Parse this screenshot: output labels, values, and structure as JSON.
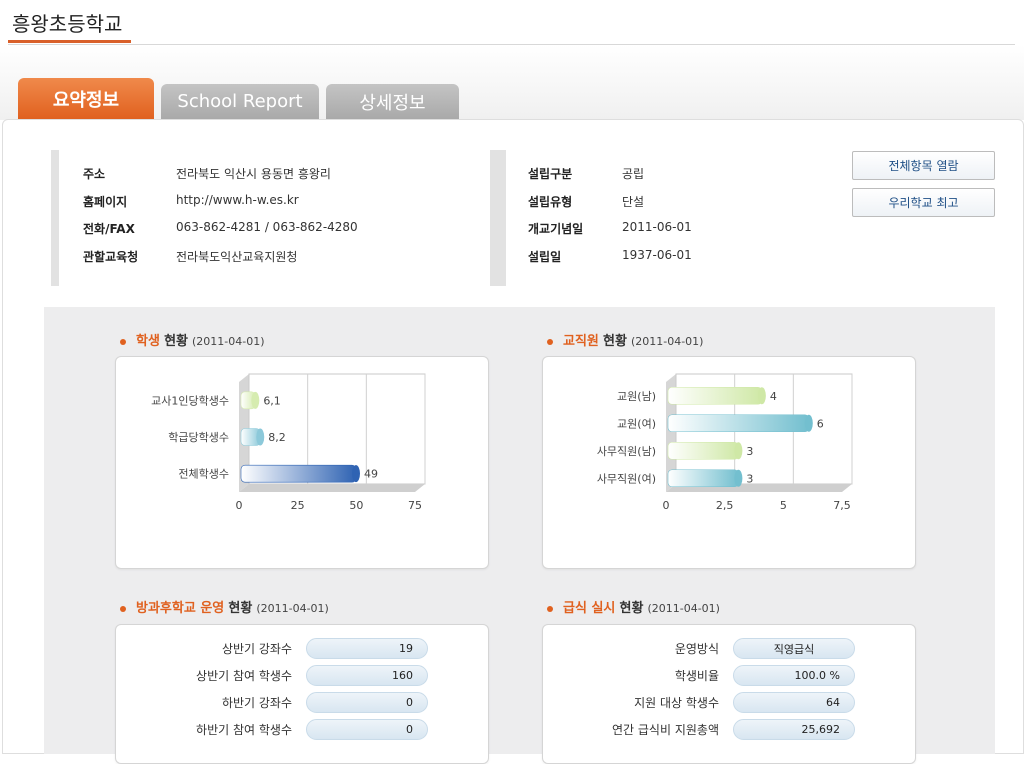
{
  "page": {
    "title": "흥왕초등학교"
  },
  "tabs": [
    {
      "label": "요약정보",
      "active": true
    },
    {
      "label": "School Report",
      "active": false
    },
    {
      "label": "상세정보",
      "active": false
    }
  ],
  "info_left": [
    {
      "label": "주소",
      "value": "전라북도 익산시 용동면 흥왕리"
    },
    {
      "label": "홈페이지",
      "value": "http://www.h-w.es.kr"
    },
    {
      "label": "전화/FAX",
      "value": "063-862-4281 / 063-862-4280"
    },
    {
      "label": "관할교육청",
      "value": "전라북도익산교육지원청"
    }
  ],
  "info_right": [
    {
      "label": "설립구분",
      "value": "공립"
    },
    {
      "label": "설립유형",
      "value": "단설"
    },
    {
      "label": "개교기념일",
      "value": "2011-06-01"
    },
    {
      "label": "설립일",
      "value": "1937-06-01"
    }
  ],
  "buttons": {
    "view_all": "전체항목 열람",
    "best": "우리학교 최고"
  },
  "sections": {
    "students": {
      "highlight": "학생",
      "rest": "현황",
      "date": "(2011-04-01)"
    },
    "staff": {
      "highlight": "교직원",
      "rest": "현황",
      "date": "(2011-04-01)"
    },
    "afterschool": {
      "highlight": "방과후학교 운영",
      "rest": "현황",
      "date": "(2011-04-01)"
    },
    "meals": {
      "highlight": "급식 실시",
      "rest": "현황",
      "date": "(2011-04-01)"
    }
  },
  "chart_data": [
    {
      "type": "bar",
      "orientation": "horizontal",
      "categories": [
        "교사1인당학생수",
        "학급당학생수",
        "전체학생수"
      ],
      "values": [
        6.1,
        8.2,
        49
      ],
      "value_labels": [
        "6,1",
        "8,2",
        "49"
      ],
      "xlim": [
        0,
        75
      ],
      "ticks": [
        "0",
        "25",
        "50",
        "75"
      ],
      "colors": [
        "#d6ecb0",
        "#8cc9da",
        "#2f63b3"
      ]
    },
    {
      "type": "bar",
      "orientation": "horizontal",
      "categories": [
        "교원(남)",
        "교원(여)",
        "사무직원(남)",
        "사무직원(여)"
      ],
      "values": [
        4,
        6,
        3,
        3
      ],
      "value_labels": [
        "4",
        "6",
        "3",
        "3"
      ],
      "xlim": [
        0,
        7.5
      ],
      "ticks": [
        "0",
        "2,5",
        "5",
        "7,5"
      ],
      "colors": [
        "#cfe8a6",
        "#73bfcf",
        "#cfe8a6",
        "#73bfcf"
      ]
    }
  ],
  "afterschool": [
    {
      "label": "상반기 강좌수",
      "value": "19"
    },
    {
      "label": "상반기 참여 학생수",
      "value": "160"
    },
    {
      "label": "하반기 강좌수",
      "value": "0"
    },
    {
      "label": "하반기 참여 학생수",
      "value": "0"
    }
  ],
  "meals": [
    {
      "label": "운영방식",
      "value": "직영급식"
    },
    {
      "label": "학생비율",
      "value": "100.0 %"
    },
    {
      "label": "지원 대상 학생수",
      "value": "64"
    },
    {
      "label": "연간 급식비 지원총액",
      "value": "25,692"
    }
  ]
}
